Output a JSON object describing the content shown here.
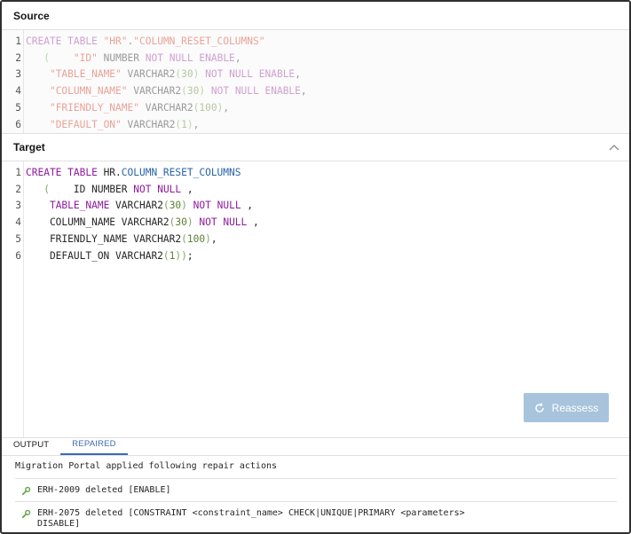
{
  "source": {
    "title": "Source",
    "lines": [
      {
        "n": "1",
        "tokens": [
          {
            "t": "CREATE TABLE ",
            "c": "kw"
          },
          {
            "t": "\"HR\"",
            "c": "str"
          },
          {
            "t": ".",
            "c": "tx"
          },
          {
            "t": "\"COLUMN_RESET_COLUMNS\"",
            "c": "str"
          }
        ]
      },
      {
        "n": "2",
        "tokens": [
          {
            "t": "   ",
            "c": "tx"
          },
          {
            "t": "(",
            "c": "pn"
          },
          {
            "t": "    ",
            "c": "tx"
          },
          {
            "t": "\"ID\"",
            "c": "str"
          },
          {
            "t": " NUMBER ",
            "c": "tx"
          },
          {
            "t": "NOT NULL ENABLE",
            "c": "kw"
          },
          {
            "t": ",",
            "c": "tx"
          }
        ]
      },
      {
        "n": "3",
        "tokens": [
          {
            "t": "    ",
            "c": "tx"
          },
          {
            "t": "\"TABLE_NAME\"",
            "c": "str"
          },
          {
            "t": " VARCHAR2",
            "c": "tx"
          },
          {
            "t": "(",
            "c": "pn"
          },
          {
            "t": "30",
            "c": "nm"
          },
          {
            "t": ")",
            "c": "pn"
          },
          {
            "t": " ",
            "c": "tx"
          },
          {
            "t": "NOT NULL ENABLE",
            "c": "kw"
          },
          {
            "t": ",",
            "c": "tx"
          }
        ]
      },
      {
        "n": "4",
        "tokens": [
          {
            "t": "    ",
            "c": "tx"
          },
          {
            "t": "\"COLUMN_NAME\"",
            "c": "str"
          },
          {
            "t": " VARCHAR2",
            "c": "tx"
          },
          {
            "t": "(",
            "c": "pn"
          },
          {
            "t": "30",
            "c": "nm"
          },
          {
            "t": ")",
            "c": "pn"
          },
          {
            "t": " ",
            "c": "tx"
          },
          {
            "t": "NOT NULL ENABLE",
            "c": "kw"
          },
          {
            "t": ",",
            "c": "tx"
          }
        ]
      },
      {
        "n": "5",
        "tokens": [
          {
            "t": "    ",
            "c": "tx"
          },
          {
            "t": "\"FRIENDLY_NAME\"",
            "c": "str"
          },
          {
            "t": " VARCHAR2",
            "c": "tx"
          },
          {
            "t": "(",
            "c": "pn"
          },
          {
            "t": "100",
            "c": "nm"
          },
          {
            "t": ")",
            "c": "pn"
          },
          {
            "t": ",",
            "c": "tx"
          }
        ]
      },
      {
        "n": "6",
        "tokens": [
          {
            "t": "    ",
            "c": "tx"
          },
          {
            "t": "\"DEFAULT_ON\"",
            "c": "str"
          },
          {
            "t": " VARCHAR2",
            "c": "tx"
          },
          {
            "t": "(",
            "c": "pn"
          },
          {
            "t": "1",
            "c": "nm"
          },
          {
            "t": ")",
            "c": "pn"
          },
          {
            "t": ",",
            "c": "tx"
          }
        ]
      }
    ]
  },
  "target": {
    "title": "Target",
    "lines": [
      {
        "n": "1",
        "tokens": [
          {
            "t": "CREATE TABLE ",
            "c": "kw"
          },
          {
            "t": "HR.",
            "c": "tx"
          },
          {
            "t": "COLUMN_RESET_COLUMNS",
            "c": "id"
          }
        ]
      },
      {
        "n": "2",
        "tokens": [
          {
            "t": "   ",
            "c": "tx"
          },
          {
            "t": "(",
            "c": "pn"
          },
          {
            "t": "    ID NUMBER ",
            "c": "tx"
          },
          {
            "t": "NOT NULL",
            "c": "kw"
          },
          {
            "t": " ,",
            "c": "tx"
          }
        ]
      },
      {
        "n": "3",
        "tokens": [
          {
            "t": "    ",
            "c": "tx"
          },
          {
            "t": "TABLE_NAME",
            "c": "col"
          },
          {
            "t": " VARCHAR2",
            "c": "tx"
          },
          {
            "t": "(",
            "c": "pn"
          },
          {
            "t": "30",
            "c": "nm"
          },
          {
            "t": ")",
            "c": "pn"
          },
          {
            "t": " ",
            "c": "tx"
          },
          {
            "t": "NOT NULL",
            "c": "kw"
          },
          {
            "t": " ,",
            "c": "tx"
          }
        ]
      },
      {
        "n": "4",
        "tokens": [
          {
            "t": "    COLUMN_NAME VARCHAR2",
            "c": "tx"
          },
          {
            "t": "(",
            "c": "pn"
          },
          {
            "t": "30",
            "c": "nm"
          },
          {
            "t": ")",
            "c": "pn"
          },
          {
            "t": " ",
            "c": "tx"
          },
          {
            "t": "NOT NULL",
            "c": "kw"
          },
          {
            "t": " ,",
            "c": "tx"
          }
        ]
      },
      {
        "n": "5",
        "tokens": [
          {
            "t": "    FRIENDLY_NAME VARCHAR2",
            "c": "tx"
          },
          {
            "t": "(",
            "c": "pn"
          },
          {
            "t": "100",
            "c": "nm"
          },
          {
            "t": ")",
            "c": "pn"
          },
          {
            "t": ",",
            "c": "tx"
          }
        ]
      },
      {
        "n": "6",
        "tokens": [
          {
            "t": "    DEFAULT_ON VARCHAR2",
            "c": "tx"
          },
          {
            "t": "(",
            "c": "pn"
          },
          {
            "t": "1",
            "c": "nm"
          },
          {
            "t": "))",
            "c": "pn"
          },
          {
            "t": ";",
            "c": "semi"
          }
        ]
      }
    ],
    "collapse_icon": "chevron-up-icon",
    "reassess_label": "Reassess",
    "reassess_icon": "refresh-icon"
  },
  "tabs": [
    {
      "label": "OUTPUT",
      "active": false
    },
    {
      "label": "REPAIRED",
      "active": true
    }
  ],
  "output": {
    "title": "Migration Portal applied following repair actions",
    "actions": [
      {
        "icon": "wrench-icon",
        "text": "ERH-2009 deleted [ENABLE]"
      },
      {
        "icon": "wrench-icon",
        "text": "ERH-2075 deleted [CONSTRAINT <constraint_name> CHECK|UNIQUE|PRIMARY <parameters>\nDISABLE]"
      }
    ]
  },
  "colors": {
    "accent": "#3e6bb5",
    "button_disabled": "#a8c4dc",
    "wrench": "#6aa84f"
  }
}
